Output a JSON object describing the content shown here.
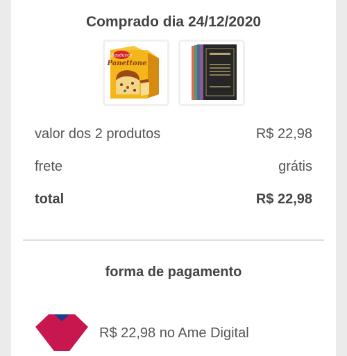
{
  "purchase": {
    "title": "Comprado dia 24/12/2020",
    "products": [
      {
        "name": "Panettone",
        "icon": "panettone-box-image"
      },
      {
        "name": "",
        "icon": "book-box-set-image"
      }
    ],
    "product_logo_text": "Bauducco",
    "product_box_text": "Panettone"
  },
  "summary": {
    "products_label": "valor dos 2 produtos",
    "products_value": "R$ 22,98",
    "shipping_label": "frete",
    "shipping_value": "grátis",
    "total_label": "total",
    "total_value": "R$ 22,98"
  },
  "payment": {
    "title": "forma de pagamento",
    "method_text": "R$ 22,98 no Ame Digital",
    "icon": "ame-digital-logo-icon",
    "colors": {
      "primary": "#c8164f",
      "secondary": "#1a3c8f"
    }
  }
}
